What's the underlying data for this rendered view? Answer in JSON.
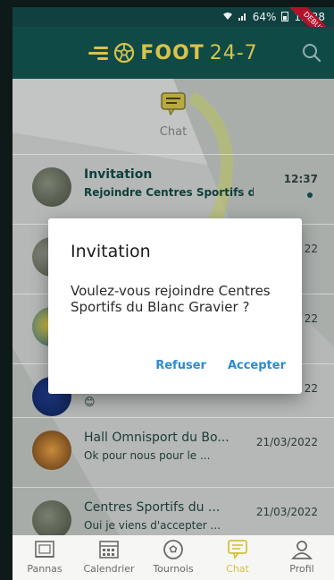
{
  "status_bar": {
    "battery": "64%",
    "time": "12:38",
    "debug_label": "DEBUG"
  },
  "app_bar": {
    "brand_text": "FOOT",
    "brand_number": "24-7"
  },
  "chat_header": {
    "label": "Chat"
  },
  "conversations": [
    {
      "title": "Invitation",
      "subtitle": "Rejoindre Centres Sportifs du ...",
      "time": "12:37",
      "unread": true
    },
    {
      "title": "",
      "subtitle": "",
      "time": "22"
    },
    {
      "title": "",
      "subtitle": "",
      "time": "22"
    },
    {
      "title": "",
      "subtitle": "😊",
      "time": "22"
    },
    {
      "title": "Hall Omnisport du Bo...",
      "subtitle": "Ok pour nous pour le ...",
      "time": "21/03/2022"
    },
    {
      "title": "Centres Sportifs du ...",
      "subtitle": "Oui je viens d'accepter ...",
      "time": "21/03/2022"
    }
  ],
  "dialog": {
    "title": "Invitation",
    "message": "Voulez-vous rejoindre Centres Sportifs du Blanc Gravier ?",
    "refuse_label": "Refuser",
    "accept_label": "Accepter"
  },
  "bottom_nav": {
    "items": [
      {
        "label": "Pannas"
      },
      {
        "label": "Calendrier"
      },
      {
        "label": "Tournois"
      },
      {
        "label": "Chat"
      },
      {
        "label": "Profil"
      }
    ],
    "active_color": "#d4c23d"
  },
  "colors": {
    "brand": "#d7c34a",
    "app_bar": "#0f4a47",
    "accent_button": "#2c8bd1"
  }
}
